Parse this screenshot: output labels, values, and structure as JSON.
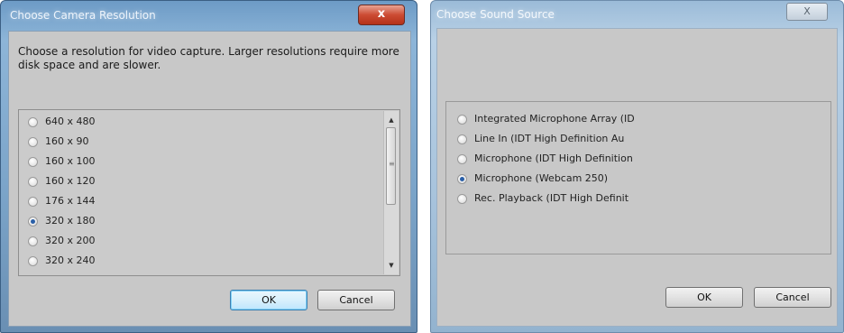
{
  "camera_dialog": {
    "title": "Choose Camera Resolution",
    "close_glyph": "x",
    "description": "Choose a resolution for video capture.  Larger resolutions require more disk space and are slower.",
    "resolutions": [
      {
        "label": "640 x 480",
        "selected": false
      },
      {
        "label": "160 x 90",
        "selected": false
      },
      {
        "label": "160 x 100",
        "selected": false
      },
      {
        "label": "160 x 120",
        "selected": false
      },
      {
        "label": "176 x 144",
        "selected": false
      },
      {
        "label": "320 x 180",
        "selected": true
      },
      {
        "label": "320 x 200",
        "selected": false
      },
      {
        "label": "320 x 240",
        "selected": false
      }
    ],
    "ok_label": "OK",
    "cancel_label": "Cancel"
  },
  "sound_dialog": {
    "title": "Choose Sound Source",
    "close_glyph": "X",
    "sources": [
      {
        "label": "Integrated Microphone Array (ID",
        "selected": false
      },
      {
        "label": "Line In (IDT High Definition Au",
        "selected": false
      },
      {
        "label": "Microphone (IDT High Definition",
        "selected": false
      },
      {
        "label": "Microphone (Webcam 250)",
        "selected": true
      },
      {
        "label": "Rec. Playback (IDT High Definit",
        "selected": false
      }
    ],
    "ok_label": "OK",
    "cancel_label": "Cancel"
  }
}
